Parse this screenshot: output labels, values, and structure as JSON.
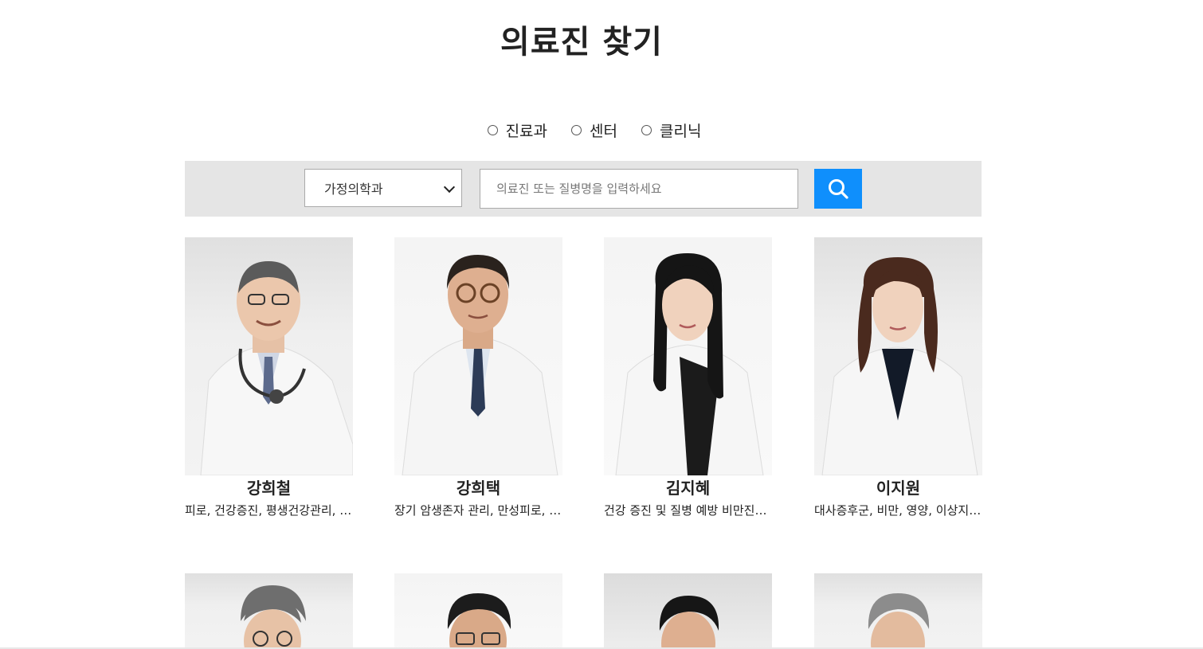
{
  "page": {
    "title": "의료진 찾기"
  },
  "filter": {
    "options": [
      {
        "label": "진료과"
      },
      {
        "label": "센터"
      },
      {
        "label": "클리닉"
      }
    ],
    "department_select": "가정의학과",
    "search_placeholder": "의료진 또는 질병명을 입력하세요"
  },
  "doctors": [
    {
      "name": "강희철",
      "specialty": "피로, 건강증진, 평생건강관리, 금연, 비만, 대사증후군"
    },
    {
      "name": "강희택",
      "specialty": "장기 암생존자 관리, 만성피로, 건강증진"
    },
    {
      "name": "김지혜",
      "specialty": "건강 증진 및 질병 예방 비만진료, 대사증후군"
    },
    {
      "name": "이지원",
      "specialty": "대사증후군, 비만, 영양, 이상지질혈증"
    }
  ],
  "colors": {
    "accent": "#0f8ffc",
    "search_bar_bg": "#e5e5e5"
  },
  "icons": {
    "search": "magnifier-icon",
    "select": "chevron-down-icon"
  }
}
